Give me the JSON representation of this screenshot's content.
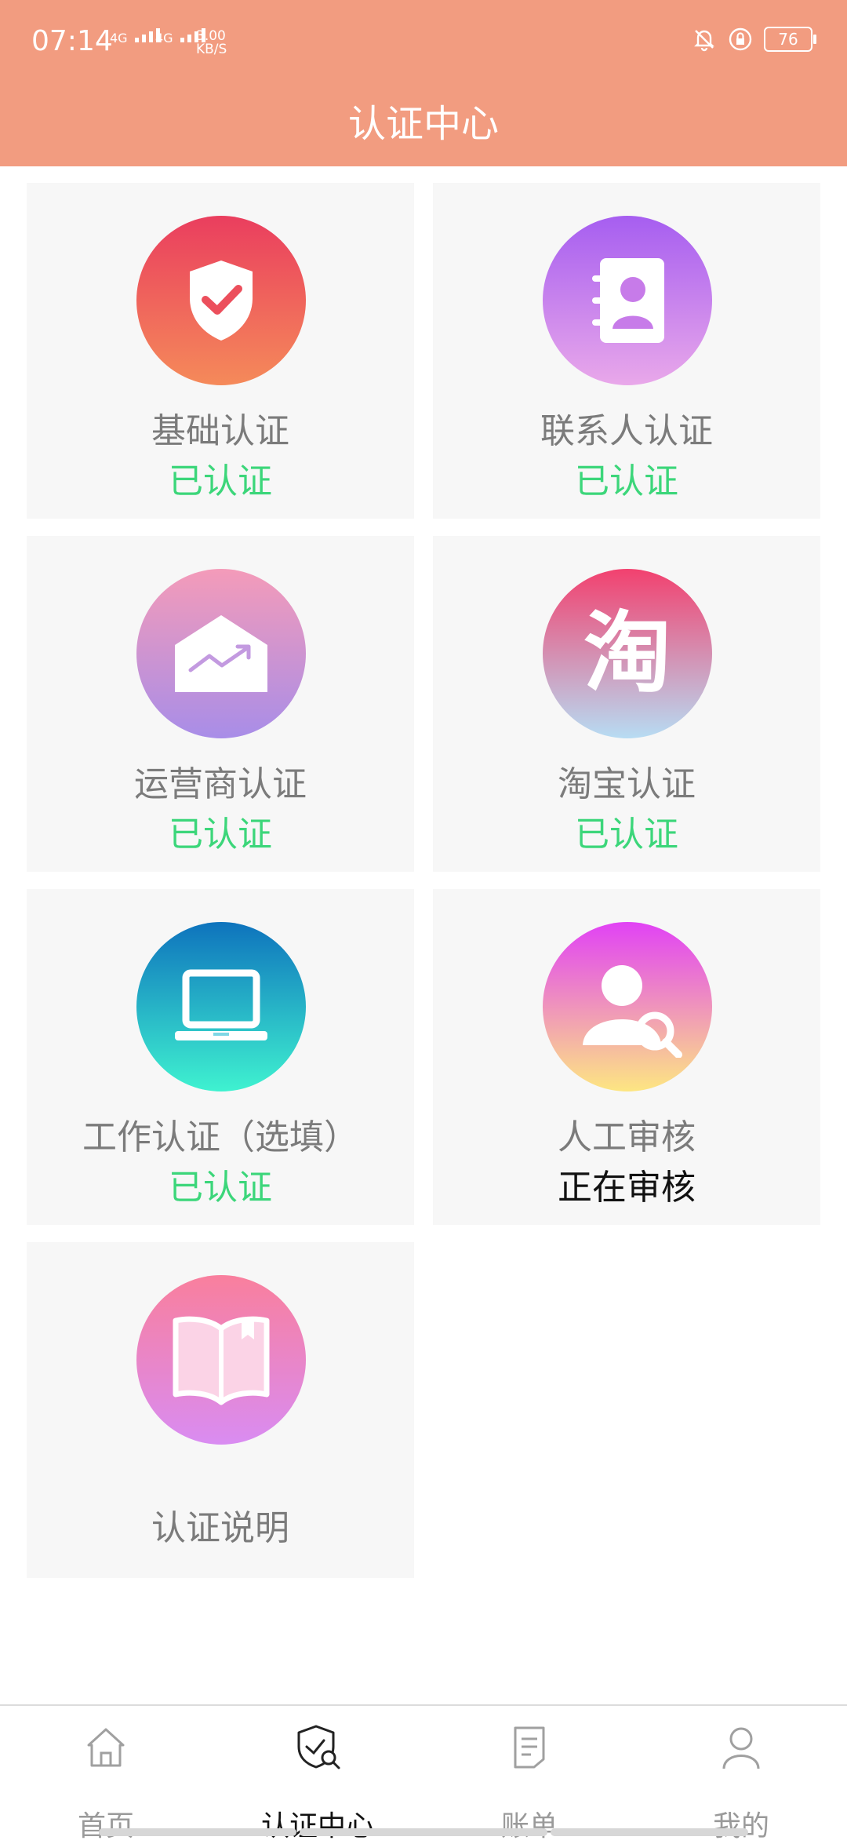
{
  "status_bar": {
    "time": "07:14",
    "net1": "4G",
    "net2": "4G",
    "speed_value": "3.00",
    "speed_unit": "KB/S",
    "battery": "76"
  },
  "header": {
    "title": "认证中心"
  },
  "cards": [
    {
      "name": "基础认证",
      "status": "已认证",
      "icon": "shield-check-icon"
    },
    {
      "name": "联系人认证",
      "status": "已认证",
      "icon": "contacts-book-icon"
    },
    {
      "name": "运营商认证",
      "status": "已认证",
      "icon": "trend-house-icon"
    },
    {
      "name": "淘宝认证",
      "status": "已认证",
      "icon": "taobao-icon",
      "glyph": "淘"
    },
    {
      "name": "工作认证（选填）",
      "status": "已认证",
      "icon": "laptop-icon"
    },
    {
      "name": "人工审核",
      "status": "正在审核",
      "icon": "user-search-icon"
    },
    {
      "name": "认证说明",
      "status": "",
      "icon": "book-icon"
    }
  ],
  "tabs": [
    {
      "label": "首页",
      "icon": "home-icon",
      "active": false
    },
    {
      "label": "认证中心",
      "icon": "shield-search-icon",
      "active": true
    },
    {
      "label": "账单",
      "icon": "document-icon",
      "active": false
    },
    {
      "label": "我的",
      "icon": "person-icon",
      "active": false
    }
  ],
  "colors": {
    "header": "#f29c80",
    "verified": "#3cd67a",
    "pending": "#111111",
    "label": "#7b7b7b"
  }
}
